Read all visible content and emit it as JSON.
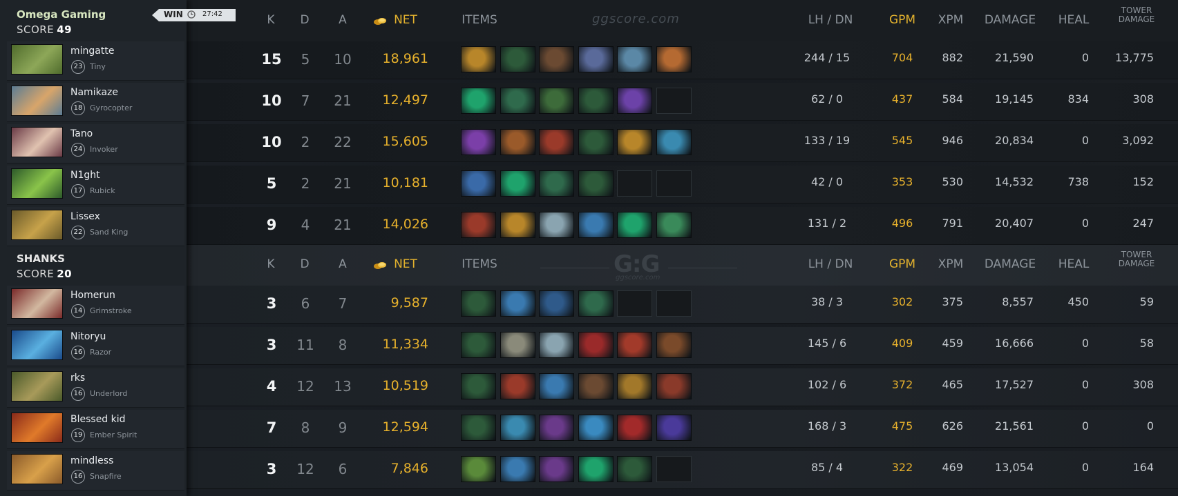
{
  "window": {
    "title": ""
  },
  "watermark": {
    "site": "ggscore.com",
    "logo_letters": "G:G",
    "logo_site": "ggscore.com"
  },
  "headers": {
    "k": "K",
    "d": "D",
    "a": "A",
    "net": "NET",
    "items": "ITEMS",
    "lh_dn": "LH  /  DN",
    "gpm": "GPM",
    "xpm": "XPM",
    "damage": "DAMAGE",
    "heal": "HEAL",
    "tower_line1": "TOWER",
    "tower_line2": "DAMAGE"
  },
  "teams": [
    {
      "name": "Omega Gaming",
      "score_label": "SCORE",
      "score": "49",
      "result": "WIN",
      "time": "27:42",
      "players": [
        {
          "name": "mingatte",
          "level": "23",
          "hero": "Tiny",
          "k": "15",
          "d": "5",
          "a": "10",
          "net": "18,961",
          "lh_dn": "244  /  15",
          "gpm": "704",
          "xpm": "882",
          "damage": "21,590",
          "heal": "0",
          "tower": "13,775",
          "portrait_colors": [
            "#4f6b2c",
            "#8da758"
          ],
          "items": [
            "#b8862a",
            "#2d5a3a",
            "#6b4a32",
            "#5a6a9a",
            "#5b88a6",
            "#b56a32"
          ]
        },
        {
          "name": "Namikaze",
          "level": "18",
          "hero": "Gyrocopter",
          "k": "10",
          "d": "7",
          "a": "21",
          "net": "12,497",
          "lh_dn": "62  /  0",
          "gpm": "437",
          "xpm": "584",
          "damage": "19,145",
          "heal": "834",
          "tower": "308",
          "portrait_colors": [
            "#5b7c94",
            "#d8a56a"
          ],
          "items": [
            "#1fa36c",
            "#2f6a4c",
            "#3d6b3a",
            "#2d5a3a",
            "#6c42a8",
            ""
          ]
        },
        {
          "name": "Tano",
          "level": "24",
          "hero": "Invoker",
          "k": "10",
          "d": "2",
          "a": "22",
          "net": "15,605",
          "lh_dn": "133  /  19",
          "gpm": "545",
          "xpm": "946",
          "damage": "20,834",
          "heal": "0",
          "tower": "3,092",
          "portrait_colors": [
            "#6a3a46",
            "#e0c2b0"
          ],
          "items": [
            "#7b3fa8",
            "#9a5a2a",
            "#9a3a2a",
            "#2d5a3a",
            "#b8862a",
            "#3a8ab0"
          ]
        },
        {
          "name": "N1ght",
          "level": "17",
          "hero": "Rubick",
          "k": "5",
          "d": "2",
          "a": "21",
          "net": "10,181",
          "lh_dn": "42  /  0",
          "gpm": "353",
          "xpm": "530",
          "damage": "14,532",
          "heal": "738",
          "tower": "152",
          "portrait_colors": [
            "#2d5a2a",
            "#8ac44a"
          ],
          "items": [
            "#3a6aa8",
            "#1fa36c",
            "#2f6a4c",
            "#2d5a3a",
            "",
            ""
          ]
        },
        {
          "name": "Lissex",
          "level": "22",
          "hero": "Sand King",
          "k": "9",
          "d": "4",
          "a": "21",
          "net": "14,026",
          "lh_dn": "131  /  2",
          "gpm": "496",
          "xpm": "791",
          "damage": "20,407",
          "heal": "0",
          "tower": "247",
          "portrait_colors": [
            "#6a5a2a",
            "#c7a24a"
          ],
          "items": [
            "#9a3a2a",
            "#b8862a",
            "#8aa4b0",
            "#3a7ab0",
            "#1fa36c",
            "#3a8a5a"
          ]
        }
      ]
    },
    {
      "name": "SHANKS",
      "score_label": "SCORE",
      "score": "20",
      "players": [
        {
          "name": "Homerun",
          "level": "14",
          "hero": "Grimstroke",
          "k": "3",
          "d": "6",
          "a": "7",
          "net": "9,587",
          "lh_dn": "38  /  3",
          "gpm": "302",
          "xpm": "375",
          "damage": "8,557",
          "heal": "450",
          "tower": "59",
          "portrait_colors": [
            "#7a2a2a",
            "#d2b8a0"
          ],
          "items": [
            "#2d5a3a",
            "#3a7ab0",
            "#2f5a8a",
            "#2f6a4c",
            "",
            ""
          ]
        },
        {
          "name": "Nitoryu",
          "level": "16",
          "hero": "Razor",
          "k": "3",
          "d": "11",
          "a": "8",
          "net": "11,334",
          "lh_dn": "145  /  6",
          "gpm": "409",
          "xpm": "459",
          "damage": "16,666",
          "heal": "0",
          "tower": "58",
          "portrait_colors": [
            "#1a4a8a",
            "#5ab0e0"
          ],
          "items": [
            "#2d5a3a",
            "#8a8a7a",
            "#8aa4b0",
            "#9a2a2a",
            "#a23a2a",
            "#7a4a2a"
          ]
        },
        {
          "name": "rks",
          "level": "16",
          "hero": "Underlord",
          "k": "4",
          "d": "12",
          "a": "13",
          "net": "10,519",
          "lh_dn": "102  /  6",
          "gpm": "372",
          "xpm": "465",
          "damage": "17,527",
          "heal": "0",
          "tower": "308",
          "portrait_colors": [
            "#4a5a2a",
            "#a89a5a"
          ],
          "items": [
            "#2d5a3a",
            "#9a3a2a",
            "#3a7ab0",
            "#6b4a32",
            "#a2782a",
            "#8a3a2a"
          ]
        },
        {
          "name": "Blessed kid",
          "level": "19",
          "hero": "Ember Spirit",
          "k": "7",
          "d": "8",
          "a": "9",
          "net": "12,594",
          "lh_dn": "168  /  3",
          "gpm": "475",
          "xpm": "626",
          "damage": "21,561",
          "heal": "0",
          "tower": "0",
          "portrait_colors": [
            "#8a2a1a",
            "#e07a2a"
          ],
          "items": [
            "#2d5a3a",
            "#3a8ab0",
            "#6a3a8a",
            "#3a8ac0",
            "#a22a2a",
            "#4a3a9a"
          ]
        },
        {
          "name": "mindless",
          "level": "16",
          "hero": "Snapfire",
          "k": "3",
          "d": "12",
          "a": "6",
          "net": "7,846",
          "lh_dn": "85  /  4",
          "gpm": "322",
          "xpm": "469",
          "damage": "13,054",
          "heal": "0",
          "tower": "164",
          "portrait_colors": [
            "#8a5a2a",
            "#d8a04a"
          ],
          "items": [
            "#5a8a3a",
            "#3a7ab0",
            "#6a3a8a",
            "#1fa36c",
            "#2d5a3a",
            ""
          ]
        }
      ]
    }
  ]
}
